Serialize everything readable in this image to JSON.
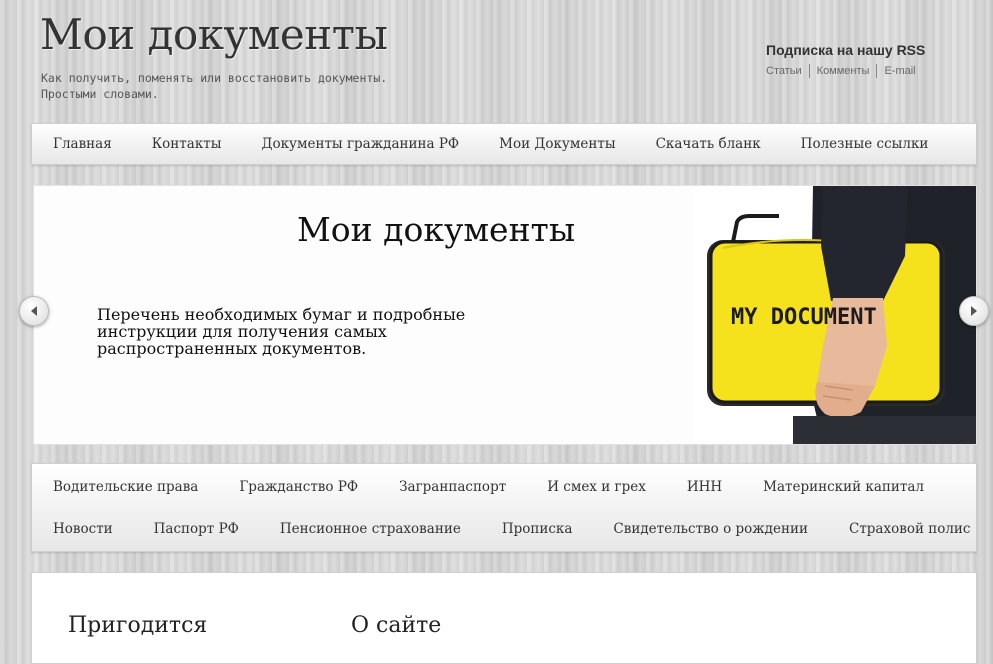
{
  "header": {
    "site_title": "Мои документы",
    "tagline": "Как получить, поменять или восстановить документы. Простыми словами."
  },
  "rss": {
    "title": "Подписка на нашу RSS",
    "links": [
      "Статьи",
      "Комменты",
      "E-mail"
    ]
  },
  "main_nav": {
    "items": [
      "Главная",
      "Контакты",
      "Документы гражданина РФ",
      "Мои Документы",
      "Скачать бланк",
      "Полезные ссылки"
    ]
  },
  "slider": {
    "title": "Мои документы",
    "text": "Перечень необходимых бумаг и подробные инструкции для получения самых распространенных документов.",
    "image_label": "MY DOCUMENT",
    "colors": {
      "folder": "#f5e21c",
      "sleeve": "#23262f"
    }
  },
  "category_nav": {
    "row1": [
      "Водительские права",
      "Гражданство РФ",
      "Загранпаспорт",
      "И смех и грех",
      "ИНН",
      "Материнский капитал"
    ],
    "row2": [
      "Новости",
      "Паспорт РФ",
      "Пенсионное страхование",
      "Прописка",
      "Свидетельство о рождении",
      "Страховой полис"
    ]
  },
  "widgets": {
    "left_title": "Пригодится",
    "right_title": "О сайте"
  },
  "icons": {
    "prev": "chevron-left-icon",
    "next": "chevron-right-icon"
  }
}
